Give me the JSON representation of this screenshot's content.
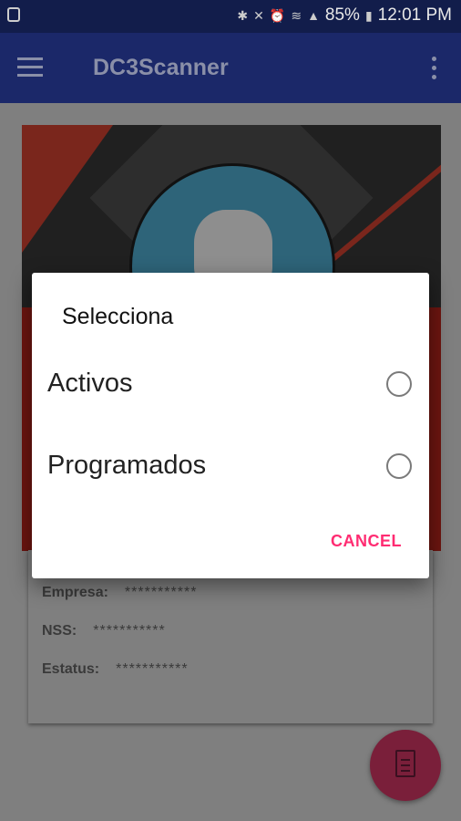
{
  "status_bar": {
    "battery": "85%",
    "time": "12:01 PM"
  },
  "app_bar": {
    "title": "DC3Scanner"
  },
  "info": {
    "rows": [
      {
        "label": "Empresa:",
        "value": "***********"
      },
      {
        "label": "NSS:",
        "value": "***********"
      },
      {
        "label": "Estatus:",
        "value": "***********"
      }
    ]
  },
  "dialog": {
    "title": "Selecciona",
    "options": [
      {
        "label": "Activos",
        "selected": false
      },
      {
        "label": "Programados",
        "selected": false
      }
    ],
    "cancel": "CANCEL"
  },
  "colors": {
    "accent": "#ff2c72",
    "primary": "#1b2869",
    "fab": "#c2185b"
  }
}
